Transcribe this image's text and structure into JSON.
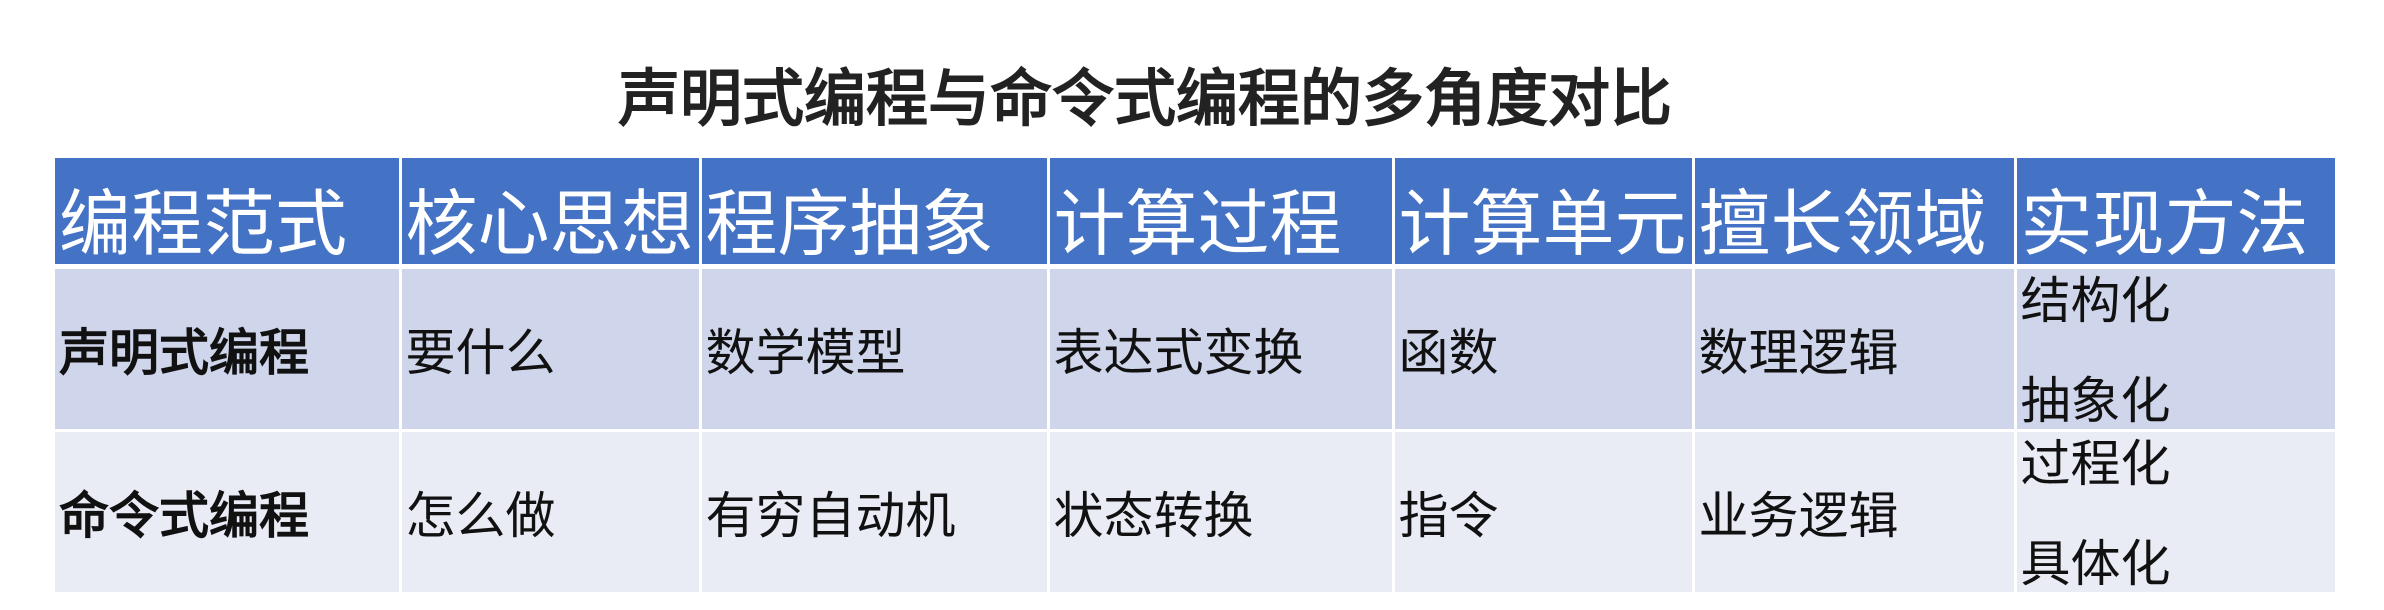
{
  "title": "声明式编程与命令式编程的多角度对比",
  "table": {
    "headers": [
      "编程范式",
      "核心思想",
      "程序抽象",
      "计算过程",
      "计算单元",
      "擅长领域",
      "实现方法"
    ],
    "rows": [
      {
        "paradigm": "声明式编程",
        "core_idea": "要什么",
        "abstraction": "数学模型",
        "process": "表达式变换",
        "unit": "函数",
        "domain": "数理逻辑",
        "method": [
          "结构化",
          "抽象化"
        ]
      },
      {
        "paradigm": "命令式编程",
        "core_idea": "怎么做",
        "abstraction": "有穷自动机",
        "process": "状态转换",
        "unit": "指令",
        "domain": "业务逻辑",
        "method": [
          "过程化",
          "具体化"
        ]
      }
    ]
  },
  "colors": {
    "header_bg": "#4472c4",
    "row_odd_bg": "#cfd5ea",
    "row_even_bg": "#e9ebf5"
  }
}
